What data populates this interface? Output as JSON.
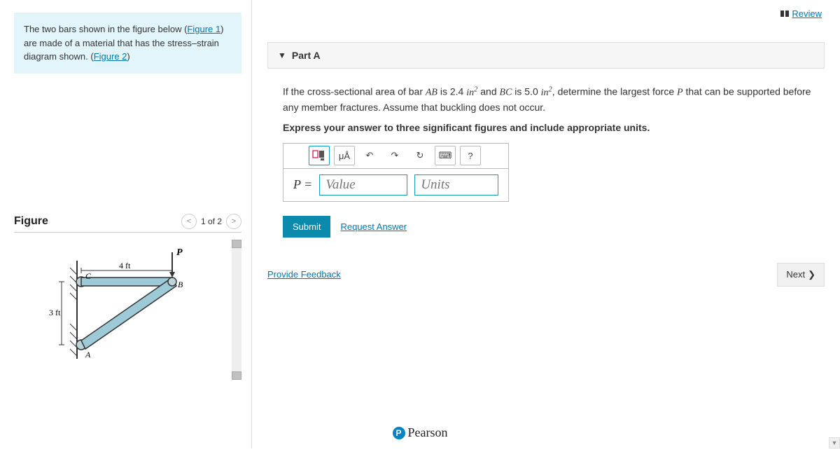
{
  "header": {
    "review_label": "Review"
  },
  "problem": {
    "text_before_link1": "The two bars shown in the figure below (",
    "link1": "Figure 1",
    "text_mid": ") are made of a material that has the stress–strain diagram shown. (",
    "link2": "Figure 2",
    "text_after": ")"
  },
  "figure": {
    "title": "Figure",
    "counter": "1 of 2",
    "prev_glyph": "<",
    "next_glyph": ">",
    "labels": {
      "P": "P",
      "len_h": "4 ft",
      "len_v": "3 ft",
      "C": "C",
      "B": "B",
      "A": "A"
    }
  },
  "part": {
    "title": "Part A",
    "question_pre": "If the cross-sectional area of bar ",
    "q_ab": "AB",
    "q_mid1": " is 2.4 ",
    "q_unit1": "in",
    "q_mid2": " and ",
    "q_bc": "BC",
    "q_mid3": " is 5.0 ",
    "q_unit2": "in",
    "q_mid4": ", determine the largest force ",
    "q_p": "P",
    "q_post": " that can be supported before any member fractures. Assume that buckling does not occur.",
    "instruct": "Express your answer to three significant figures and include appropriate units.",
    "lhs": "P =",
    "value_placeholder": "Value",
    "units_placeholder": "Units",
    "submit": "Submit",
    "request_answer": "Request Answer",
    "toolbar": {
      "templates": "▭",
      "muA": "μÅ",
      "undo": "↶",
      "redo": "↷",
      "reset": "↻",
      "keyboard": "⌨",
      "help": "?"
    }
  },
  "feedback_link": "Provide Feedback",
  "next_label": "Next",
  "footer_brand": "Pearson"
}
